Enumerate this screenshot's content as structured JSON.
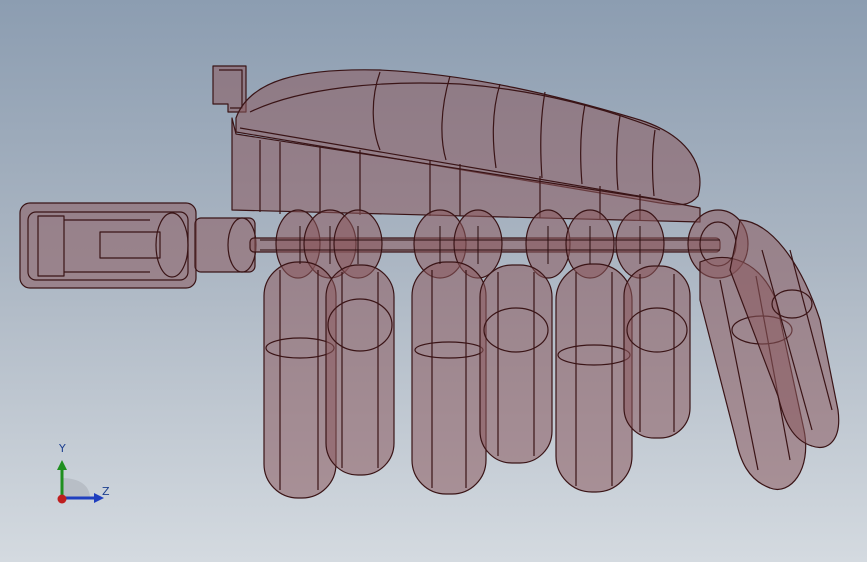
{
  "viewport": {
    "background_top": "#8c9db1",
    "background_bottom": "#d4dae0",
    "model_fill": "#8a5a5e",
    "model_edge": "#3a1416"
  },
  "model": {
    "name": "robotic-hand-assembly",
    "render_mode": "transparent-with-edges",
    "fingers": 7
  },
  "triad": {
    "y_label": "Y",
    "z_label": "Z",
    "y_color": "#1f8f1f",
    "z_color": "#1f3fbf",
    "x_color": "#bf1f1f"
  }
}
